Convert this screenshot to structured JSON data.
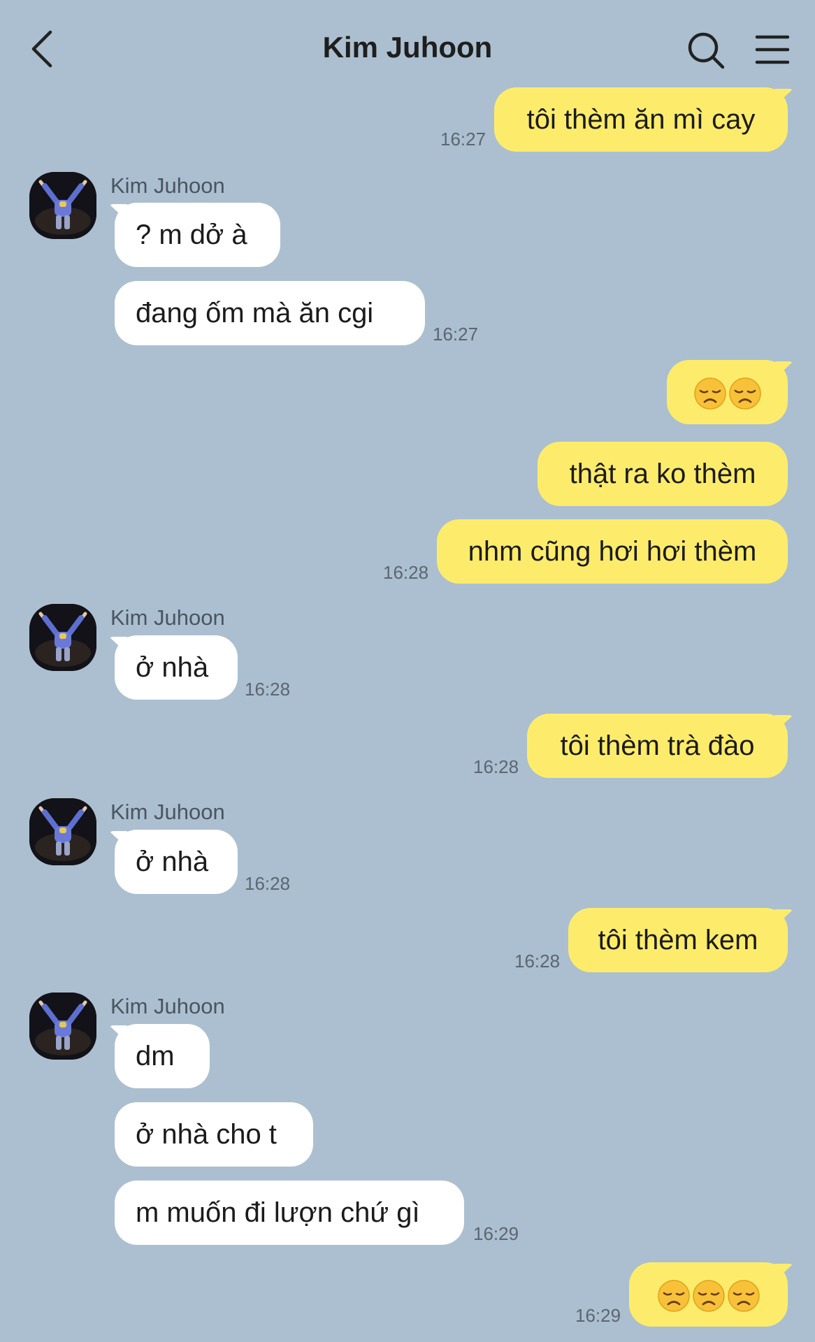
{
  "header": {
    "title": "Kim Juhoon",
    "back_icon": "chevron-left-icon",
    "search_icon": "search-icon",
    "menu_icon": "hamburger-menu-icon"
  },
  "colors": {
    "background": "#abbfd0",
    "incoming_bubble": "#ffffff",
    "outgoing_bubble": "#fdec6b"
  },
  "contact": {
    "name": "Kim Juhoon"
  },
  "messages": [
    {
      "from": "me",
      "text": "tôi thèm ăn mì cay",
      "time": "16:27"
    },
    {
      "from": "Kim Juhoon",
      "text": "? m dở à"
    },
    {
      "from": "Kim Juhoon",
      "text": "đang ốm mà ăn cgi",
      "time": "16:27"
    },
    {
      "from": "me",
      "emoji": "disappointed-face",
      "count": 2
    },
    {
      "from": "me",
      "text": "thật ra ko thèm"
    },
    {
      "from": "me",
      "text": "nhm cũng hơi hơi thèm",
      "time": "16:28"
    },
    {
      "from": "Kim Juhoon",
      "text": "ở nhà",
      "time": "16:28"
    },
    {
      "from": "me",
      "text": "tôi thèm trà đào",
      "time": "16:28"
    },
    {
      "from": "Kim Juhoon",
      "text": "ở nhà",
      "time": "16:28"
    },
    {
      "from": "me",
      "text": "tôi thèm kem",
      "time": "16:28"
    },
    {
      "from": "Kim Juhoon",
      "text": "dm"
    },
    {
      "from": "Kim Juhoon",
      "text": "ở nhà cho t"
    },
    {
      "from": "Kim Juhoon",
      "text": "m muốn đi lượn chứ gì",
      "time": "16:29"
    },
    {
      "from": "me",
      "emoji": "disappointed-face",
      "count": 3,
      "time": "16:29"
    }
  ]
}
